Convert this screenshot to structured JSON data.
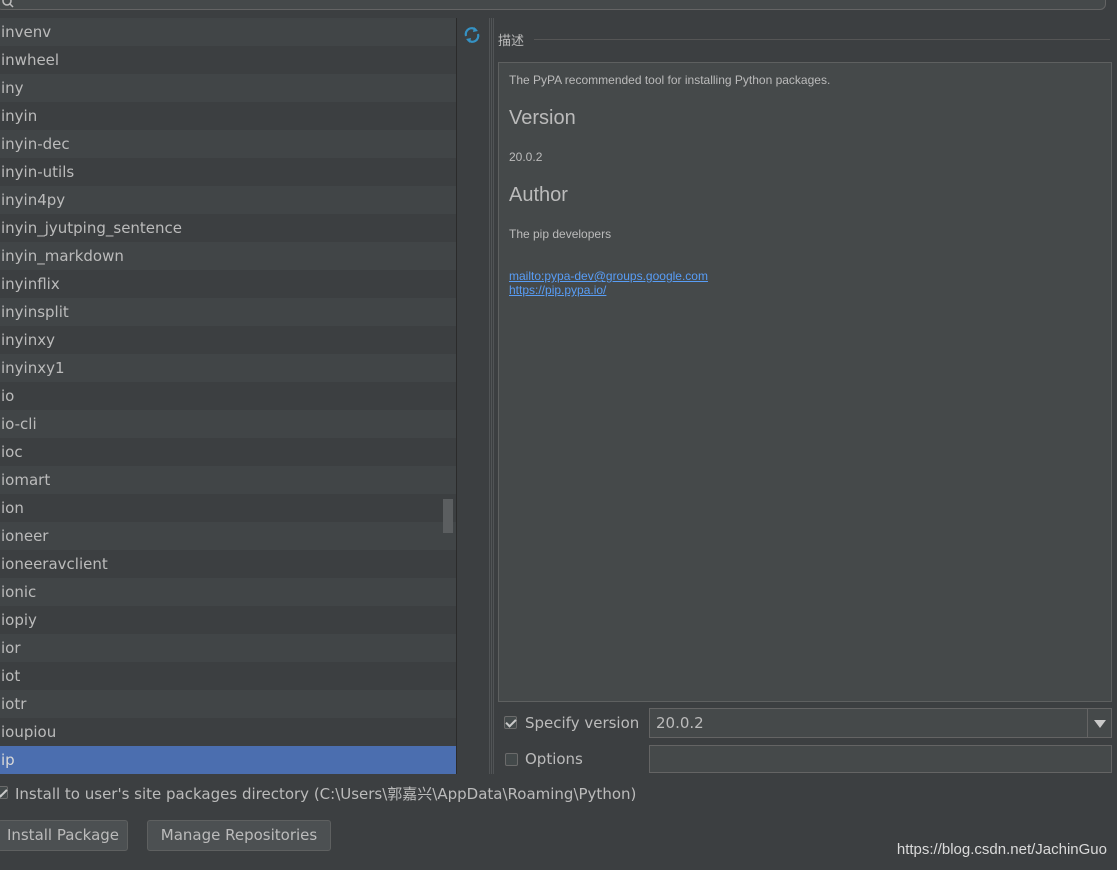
{
  "packages": [
    "invenv",
    "inwheel",
    "iny",
    "inyin",
    "inyin-dec",
    "inyin-utils",
    "inyin4py",
    "inyin_jyutping_sentence",
    "inyin_markdown",
    "inyinflix",
    "inyinsplit",
    "inyinxy",
    "inyinxy1",
    "io",
    "io-cli",
    "ioc",
    "iomart",
    "ion",
    "ioneer",
    "ioneeravclient",
    "ionic",
    "iopiy",
    "ior",
    "iot",
    "iotr",
    "ioupiou",
    "ip"
  ],
  "selected_package": "ip",
  "description": {
    "header": "描述",
    "summary": "The PyPA recommended tool for installing Python packages.",
    "version_heading": "Version",
    "version_value": "20.0.2",
    "author_heading": "Author",
    "author_value": "The pip developers",
    "link_email": "mailto:pypa-dev@groups.google.com",
    "link_site": "https://pip.pypa.io/"
  },
  "specify_version": {
    "label": "Specify version",
    "checked": true,
    "value": "20.0.2"
  },
  "options": {
    "label": "Options",
    "checked": false,
    "value": ""
  },
  "install_user": {
    "label": "Install to user's site packages directory (C:\\Users\\郭嘉兴\\AppData\\Roaming\\Python)",
    "checked": true
  },
  "buttons": {
    "install": "Install Package",
    "manage": "Manage Repositories"
  },
  "watermark": "https://blog.csdn.net/JachinGuo",
  "colors": {
    "background": "#3c3f41",
    "selection": "#4b6eaf",
    "link": "#589df6",
    "refresh_icon": "#3592c4"
  }
}
